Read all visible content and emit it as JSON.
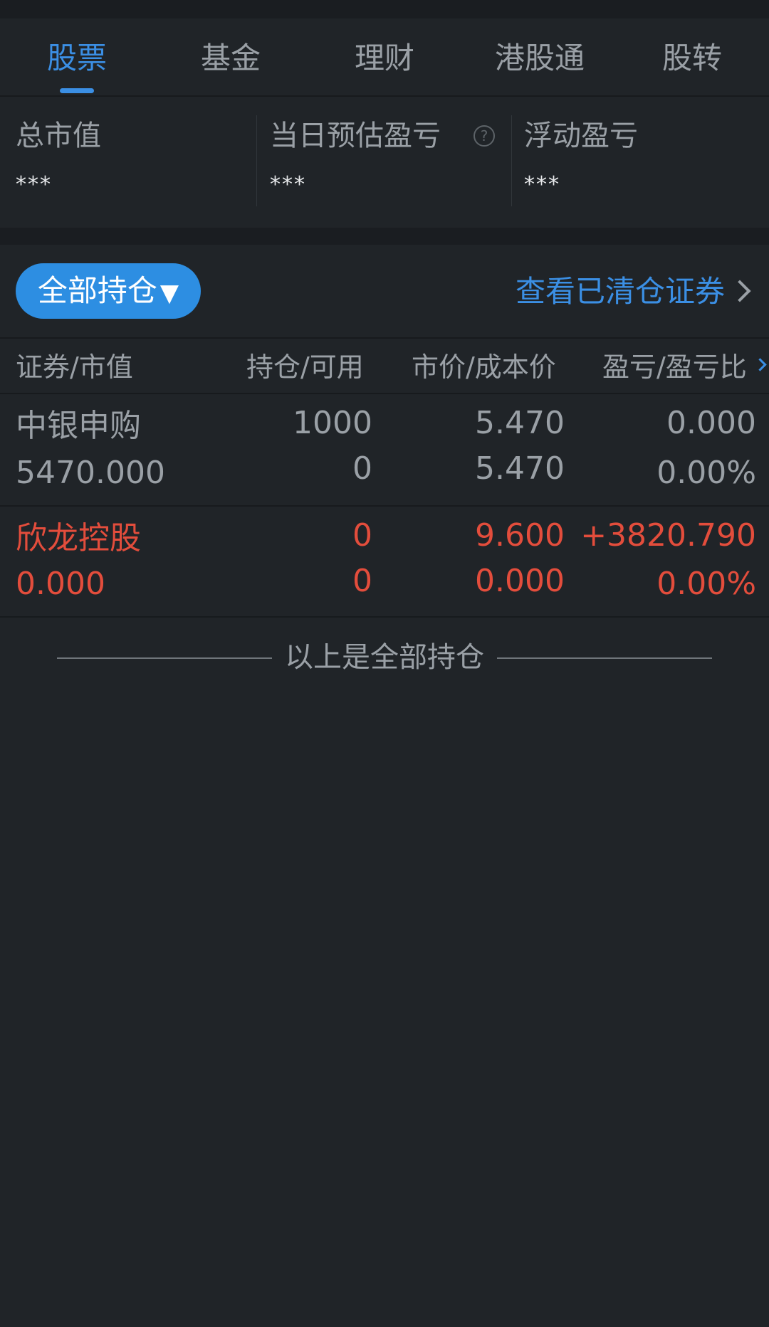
{
  "tabs": [
    {
      "label": "股票",
      "active": true
    },
    {
      "label": "基金",
      "active": false
    },
    {
      "label": "理财",
      "active": false
    },
    {
      "label": "港股通",
      "active": false
    },
    {
      "label": "股转",
      "active": false
    }
  ],
  "summary": {
    "total_market_value": {
      "label": "总市值",
      "value": "***"
    },
    "daily_estimated_pnl": {
      "label": "当日预估盈亏",
      "value": "***",
      "help_icon": "?"
    },
    "floating_pnl": {
      "label": "浮动盈亏",
      "value": "***"
    }
  },
  "filter": {
    "all_positions_label": "全部持仓",
    "dropdown_glyph": "▼",
    "view_cleared_label": "查看已清仓证券"
  },
  "table": {
    "headers": [
      "证券/市值",
      "持仓/可用",
      "市价/成本价",
      "盈亏/盈亏比"
    ],
    "rows": [
      {
        "name": "中银申购",
        "market_value": "5470.000",
        "position": "1000",
        "available": "0",
        "market_price": "5.470",
        "cost_price": "5.470",
        "pnl": "0.000",
        "pnl_ratio": "0.00%",
        "color": "gray"
      },
      {
        "name": "欣龙控股",
        "market_value": "0.000",
        "position": "0",
        "available": "0",
        "market_price": "9.600",
        "cost_price": "0.000",
        "pnl": "+3820.790",
        "pnl_ratio": "0.00%",
        "color": "red"
      }
    ]
  },
  "footer_note": "以上是全部持仓",
  "colors": {
    "background": "#202428",
    "accent": "#3b8fe4",
    "loss_gain_red": "#e34d3c",
    "text_gray": "#9aa0a6"
  }
}
